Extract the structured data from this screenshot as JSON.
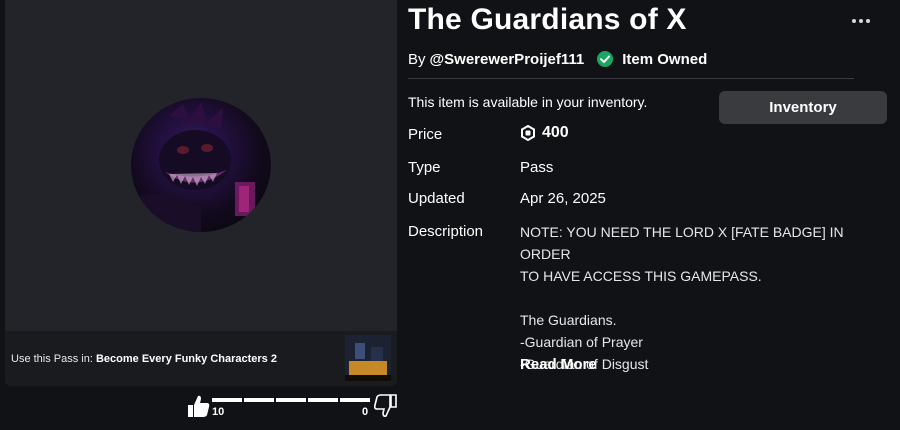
{
  "item": {
    "title": "The Guardians of X",
    "creator_prefix": "By",
    "creator_name": "@SwerewerProijef111",
    "owned_label": "Item Owned",
    "availability_text": "This item is available in your inventory.",
    "inventory_button": "Inventory",
    "price_label": "Price",
    "price_value": "400",
    "type_label": "Type",
    "type_value": "Pass",
    "updated_label": "Updated",
    "updated_value": "Apr 26, 2025",
    "description_label": "Description",
    "description_lines": [
      "NOTE: YOU NEED THE LORD X [FATE BADGE] IN ORDER",
      "TO HAVE ACCESS THIS GAMEPASS.",
      "",
      "The Guardians.",
      "-Guardian of Prayer",
      "-Guardian of Disgust"
    ],
    "read_more": "Read More"
  },
  "media": {
    "use_prefix": "Use this Pass in: ",
    "game_name": "Become Every Funky Characters 2"
  },
  "votes": {
    "up_count": "10",
    "down_count": "0",
    "up_fraction": 1.0
  },
  "icons": {
    "owned": "check-circle-icon",
    "currency": "robux-icon",
    "more": "more-options-icon",
    "thumbs_up": "thumbs-up-icon",
    "thumbs_down": "thumbs-down-icon"
  },
  "colors": {
    "background": "#111216",
    "panel": "#232429",
    "button": "#393b3f",
    "owned_green": "#1ba662"
  }
}
